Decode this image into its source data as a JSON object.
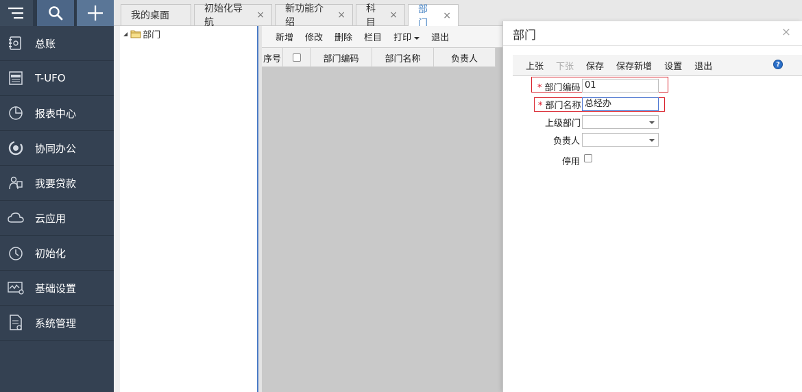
{
  "topbar": {
    "menu_icon": "menu-icon",
    "search_icon": "search-icon",
    "add_icon": "plus-icon",
    "tabs": [
      {
        "label": "我的桌面",
        "closable": false,
        "active": false
      },
      {
        "label": "初始化导航",
        "closable": true,
        "active": false
      },
      {
        "label": "新功能介绍",
        "closable": true,
        "active": false
      },
      {
        "label": "科目",
        "closable": true,
        "active": false
      },
      {
        "label": "部门",
        "closable": true,
        "active": true
      }
    ],
    "close_glyph": "×"
  },
  "sidebar": {
    "items": [
      {
        "label": "总账",
        "icon": "ledger-icon"
      },
      {
        "label": "T-UFO",
        "icon": "tufo-icon"
      },
      {
        "label": "报表中心",
        "icon": "pie-chart-icon"
      },
      {
        "label": "协同办公",
        "icon": "collaboration-icon"
      },
      {
        "label": "我要贷款",
        "icon": "loan-icon"
      },
      {
        "label": "云应用",
        "icon": "cloud-icon"
      },
      {
        "label": "初始化",
        "icon": "clock-icon"
      },
      {
        "label": "基础设置",
        "icon": "settings-monitor-icon"
      },
      {
        "label": "系统管理",
        "icon": "document-gear-icon"
      }
    ]
  },
  "tree": {
    "root_label": "部门",
    "root_icon": "folder-icon"
  },
  "grid": {
    "toolbar": [
      "新增",
      "修改",
      "删除",
      "栏目",
      "打印",
      "退出"
    ],
    "columns": [
      "序号",
      "",
      "部门编码",
      "部门名称",
      "负责人"
    ]
  },
  "dialog": {
    "title": "部门",
    "close": "×",
    "toolbar": [
      {
        "label": "上张",
        "disabled": false
      },
      {
        "label": "下张",
        "disabled": true
      },
      {
        "label": "保存",
        "disabled": false
      },
      {
        "label": "保存新增",
        "disabled": false
      },
      {
        "label": "设置",
        "disabled": false
      },
      {
        "label": "退出",
        "disabled": false
      }
    ],
    "help_glyph": "?",
    "fields": {
      "code": {
        "label": "部门编码",
        "required": true,
        "value": "01"
      },
      "name": {
        "label": "部门名称",
        "required": true,
        "value": "总经办"
      },
      "parent": {
        "label": "上级部门",
        "value": ""
      },
      "manager": {
        "label": "负责人",
        "value": ""
      },
      "disabled": {
        "label": "停用",
        "checked": false
      }
    },
    "required_mark": "*"
  },
  "colors": {
    "sidebar_bg": "#344152",
    "active_tab_text": "#4a86c5",
    "required_border": "#d9232d",
    "splitter_accent": "#4a7bc6"
  }
}
